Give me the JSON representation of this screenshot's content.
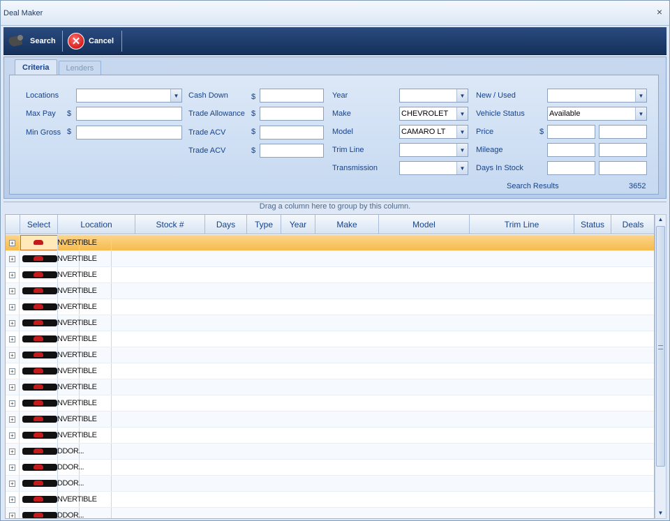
{
  "window": {
    "title": "Deal Maker",
    "close_label": "×"
  },
  "toolbar": {
    "search_label": "Search",
    "cancel_label": "Cancel"
  },
  "tabs": [
    {
      "label": "Criteria",
      "active": true
    },
    {
      "label": "Lenders",
      "active": false
    }
  ],
  "criteria": {
    "locations_label": "Locations",
    "max_pay_label": "Max Pay",
    "min_gross_label": "Min Gross",
    "cash_down_label": "Cash Down",
    "trade_allowance_label": "Trade Allowance",
    "trade_acv_label_1": "Trade ACV",
    "trade_acv_label_2": "Trade ACV",
    "year_label": "Year",
    "make_label": "Make",
    "make_value": "CHEVROLET",
    "model_label": "Model",
    "model_value": "CAMARO LT",
    "trim_line_label": "Trim Line",
    "transmission_label": "Transmission",
    "new_used_label": "New / Used",
    "vehicle_status_label": "Vehicle Status",
    "vehicle_status_value": "Available",
    "price_label": "Price",
    "mileage_label": "Mileage",
    "days_in_stock_label": "Days In Stock",
    "currency_symbol": "$",
    "search_results_label": "Search Results",
    "search_results_count": "3652"
  },
  "grid": {
    "group_hint": "Drag a column here to group by this column.",
    "columns": [
      "Select",
      "Location",
      "Stock #",
      "Days",
      "Type",
      "Year",
      "Make",
      "Model",
      "Trim Line",
      "Status",
      "Deals"
    ],
    "rows": [
      {
        "text": "NVERTIBLE",
        "selected": true
      },
      {
        "text": "NVERTIBLE"
      },
      {
        "text": "NVERTIBLE"
      },
      {
        "text": "NVERTIBLE"
      },
      {
        "text": "NVERTIBLE"
      },
      {
        "text": "NVERTIBLE"
      },
      {
        "text": "NVERTIBLE"
      },
      {
        "text": "NVERTIBLE"
      },
      {
        "text": "NVERTIBLE"
      },
      {
        "text": "NVERTIBLE"
      },
      {
        "text": "NVERTIBLE"
      },
      {
        "text": "NVERTIBLE"
      },
      {
        "text": "NVERTIBLE"
      },
      {
        "text": "DDOR..."
      },
      {
        "text": "DDOR..."
      },
      {
        "text": "DDOR..."
      },
      {
        "text": "NVERTIBLE"
      },
      {
        "text": "DDOR..."
      }
    ]
  }
}
